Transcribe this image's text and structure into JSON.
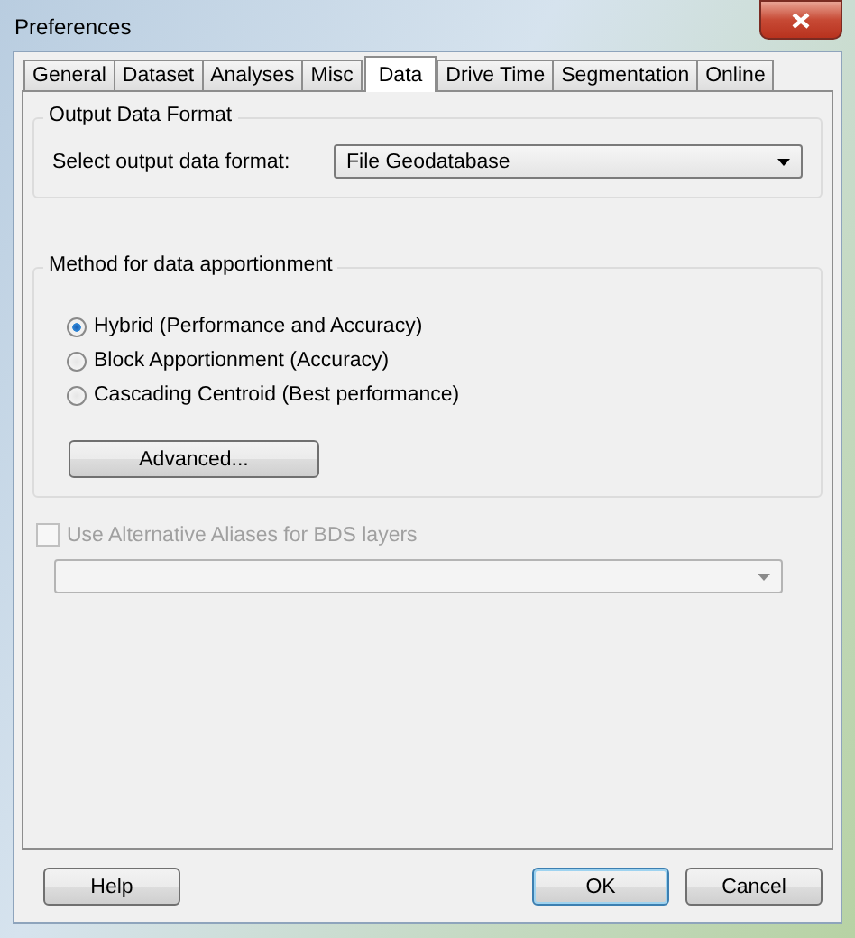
{
  "window": {
    "title": "Preferences"
  },
  "tabs": [
    {
      "label": "General",
      "selected": false
    },
    {
      "label": "Dataset",
      "selected": false
    },
    {
      "label": "Analyses",
      "selected": false
    },
    {
      "label": "Misc",
      "selected": false
    },
    {
      "label": "Data",
      "selected": true
    },
    {
      "label": "Drive Time",
      "selected": false
    },
    {
      "label": "Segmentation",
      "selected": false
    },
    {
      "label": "Online",
      "selected": false
    }
  ],
  "output_format": {
    "legend": "Output Data Format",
    "label": "Select output data format:",
    "value": "File Geodatabase"
  },
  "apportionment": {
    "legend": "Method for data apportionment",
    "options": [
      {
        "label": "Hybrid (Performance and Accuracy)",
        "selected": true
      },
      {
        "label": "Block Apportionment (Accuracy)",
        "selected": false
      },
      {
        "label": "Cascading Centroid (Best performance)",
        "selected": false
      }
    ],
    "advanced_button": "Advanced..."
  },
  "aliases": {
    "label": "Use Alternative Aliases for BDS layers",
    "checked": false,
    "disabled": true
  },
  "buttons": [
    {
      "label": "Help",
      "default": false
    },
    {
      "label": "OK",
      "default": true
    },
    {
      "label": "Cancel",
      "default": false
    }
  ]
}
